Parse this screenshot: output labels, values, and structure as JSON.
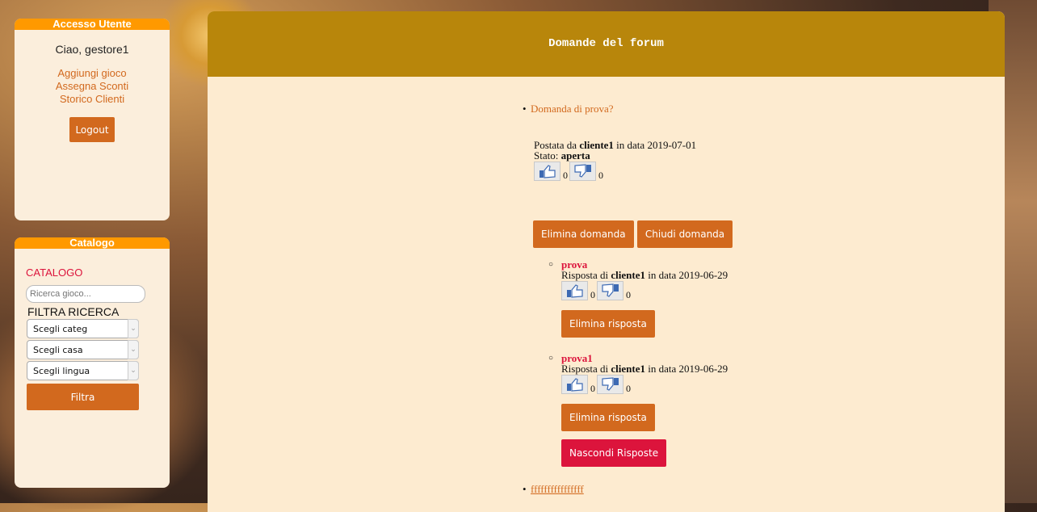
{
  "user_panel": {
    "header": "Accesso Utente",
    "greeting": "Ciao, gestore1",
    "links": [
      "Aggiungi gioco",
      "Assegna Sconti",
      "Storico Clienti"
    ],
    "logout_label": "Logout"
  },
  "catalog_panel": {
    "header": "Catalogo",
    "title": "CATALOGO",
    "search_placeholder": "Ricerca gioco...",
    "filter_label": "FILTRA RICERCA",
    "selects": [
      "Scegli categ",
      "Scegli casa",
      "Scegli lingua"
    ],
    "filter_button": "Filtra"
  },
  "main": {
    "title": "Domande del forum",
    "question": {
      "text": "Domanda di prova?",
      "posted_prefix": "Postata da",
      "author": "cliente1",
      "date_prefix": "in data",
      "date": "2019-07-01",
      "status_label": "Stato:",
      "status": "aperta",
      "likes": "0",
      "dislikes": "0",
      "delete_label": "Elimina domanda",
      "close_label": "Chiudi domanda"
    },
    "answers": [
      {
        "title": "prova",
        "prefix": "Risposta di",
        "author": "cliente1",
        "date_prefix": "in data",
        "date": "2019-06-29",
        "likes": "0",
        "dislikes": "0",
        "delete_label": "Elimina risposta"
      },
      {
        "title": "prova1",
        "prefix": "Risposta di",
        "author": "cliente1",
        "date_prefix": "in data",
        "date": "2019-06-29",
        "likes": "0",
        "dislikes": "0",
        "delete_label": "Elimina risposta"
      }
    ],
    "hide_answers_label": "Nascondi Risposte",
    "next_question": "ffffffffffffffff"
  }
}
